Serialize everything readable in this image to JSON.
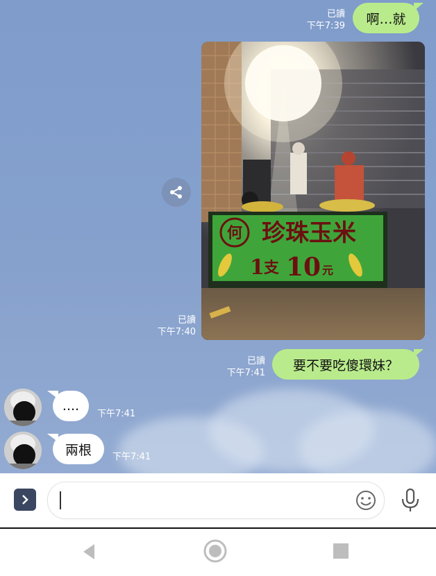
{
  "messages": [
    {
      "side": "right",
      "type": "text",
      "text": "啊…就",
      "read": "已讀",
      "time": "下午7:39"
    },
    {
      "side": "right",
      "type": "image",
      "read": "已讀",
      "time": "下午7:40",
      "photo": {
        "sign_top": "何",
        "sign_title": "珍珠玉米",
        "sign_price_1": "1",
        "sign_price_unit": "支",
        "sign_price_2": "10",
        "sign_price_currency": "元"
      }
    },
    {
      "side": "right",
      "type": "text",
      "text": "要不要吃傻環妹？",
      "read": "已讀",
      "time": "下午7:41"
    },
    {
      "side": "left",
      "type": "text",
      "text": "....",
      "time": "下午7:41"
    },
    {
      "side": "left",
      "type": "text",
      "text": "兩根",
      "time": "下午7:41"
    }
  ],
  "input": {
    "value": "",
    "placeholder": ""
  },
  "icons": {
    "share": "share-icon",
    "expand": "chevron-right-icon",
    "emoji": "smiley-icon",
    "mic": "microphone-icon",
    "back": "back-triangle-icon",
    "home": "home-circle-icon",
    "recents": "recents-square-icon"
  },
  "colors": {
    "chat_bg": "#7f9ccb",
    "bubble_sent": "#b9eb8c",
    "bubble_received": "#ffffff",
    "sign_green": "#3fa53a",
    "sign_text": "#6b1010"
  }
}
